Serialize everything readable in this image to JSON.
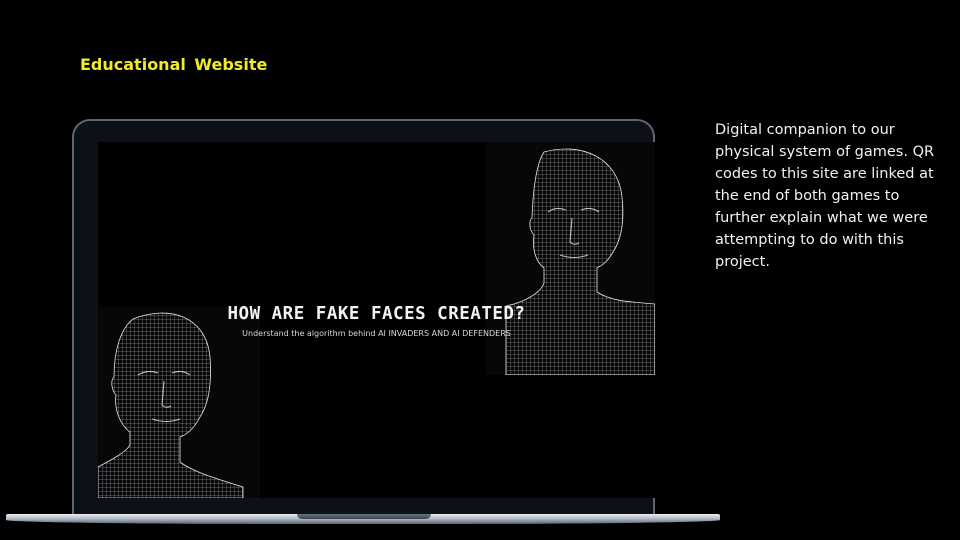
{
  "slide": {
    "title": "Educational  Website",
    "description": "Digital companion to our physical system of games. QR codes to this site are linked at the end of both games to further explain what we were attempting to do with this project."
  },
  "website": {
    "headline": "HOW ARE FAKE FACES CREATED?",
    "subtitle": "Understand the algorithm behind AI INVADERS AND AI DEFENDERS"
  },
  "colors": {
    "background": "#000000",
    "title_accent": "#f0ea2a",
    "body_text": "#f2f2f2",
    "wireframe": "#cfd3d8"
  },
  "icons": [
    "wireframe-face-image",
    "laptop-mockup"
  ]
}
